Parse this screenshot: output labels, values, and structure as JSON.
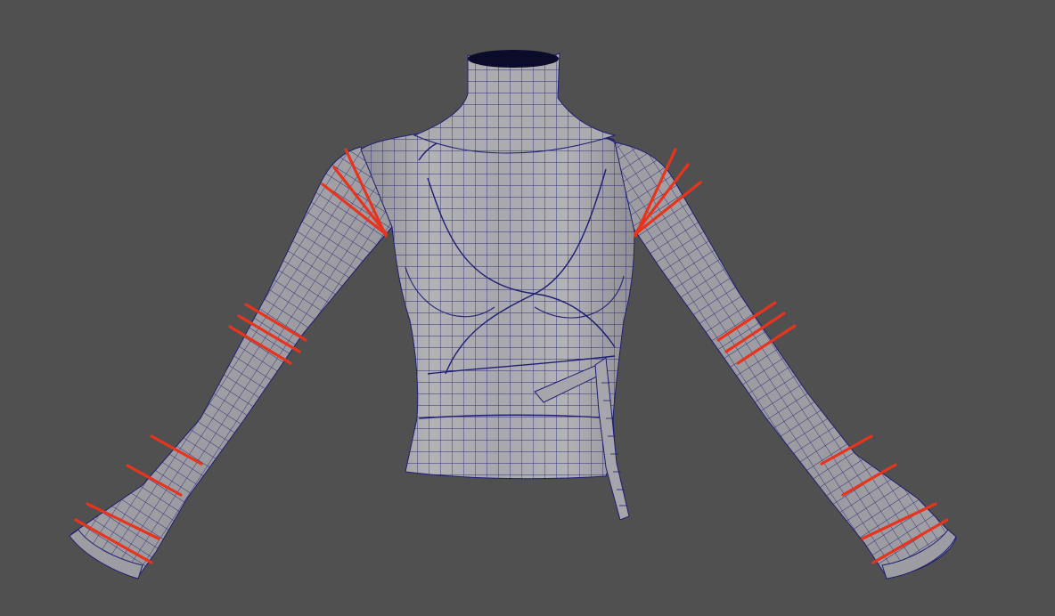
{
  "viewport": {
    "background_color": "#505050",
    "mesh_fill_color": "#a9a8ad",
    "mesh_shade_color": "#8e8d93",
    "wire_color": "#1f1f73",
    "highlight_edge_color": "#e8341c",
    "neck_hole_color": "#0b0b2a",
    "object": "wrap-top-sweater-mesh",
    "display_mode": "wireframe-on-shaded"
  }
}
